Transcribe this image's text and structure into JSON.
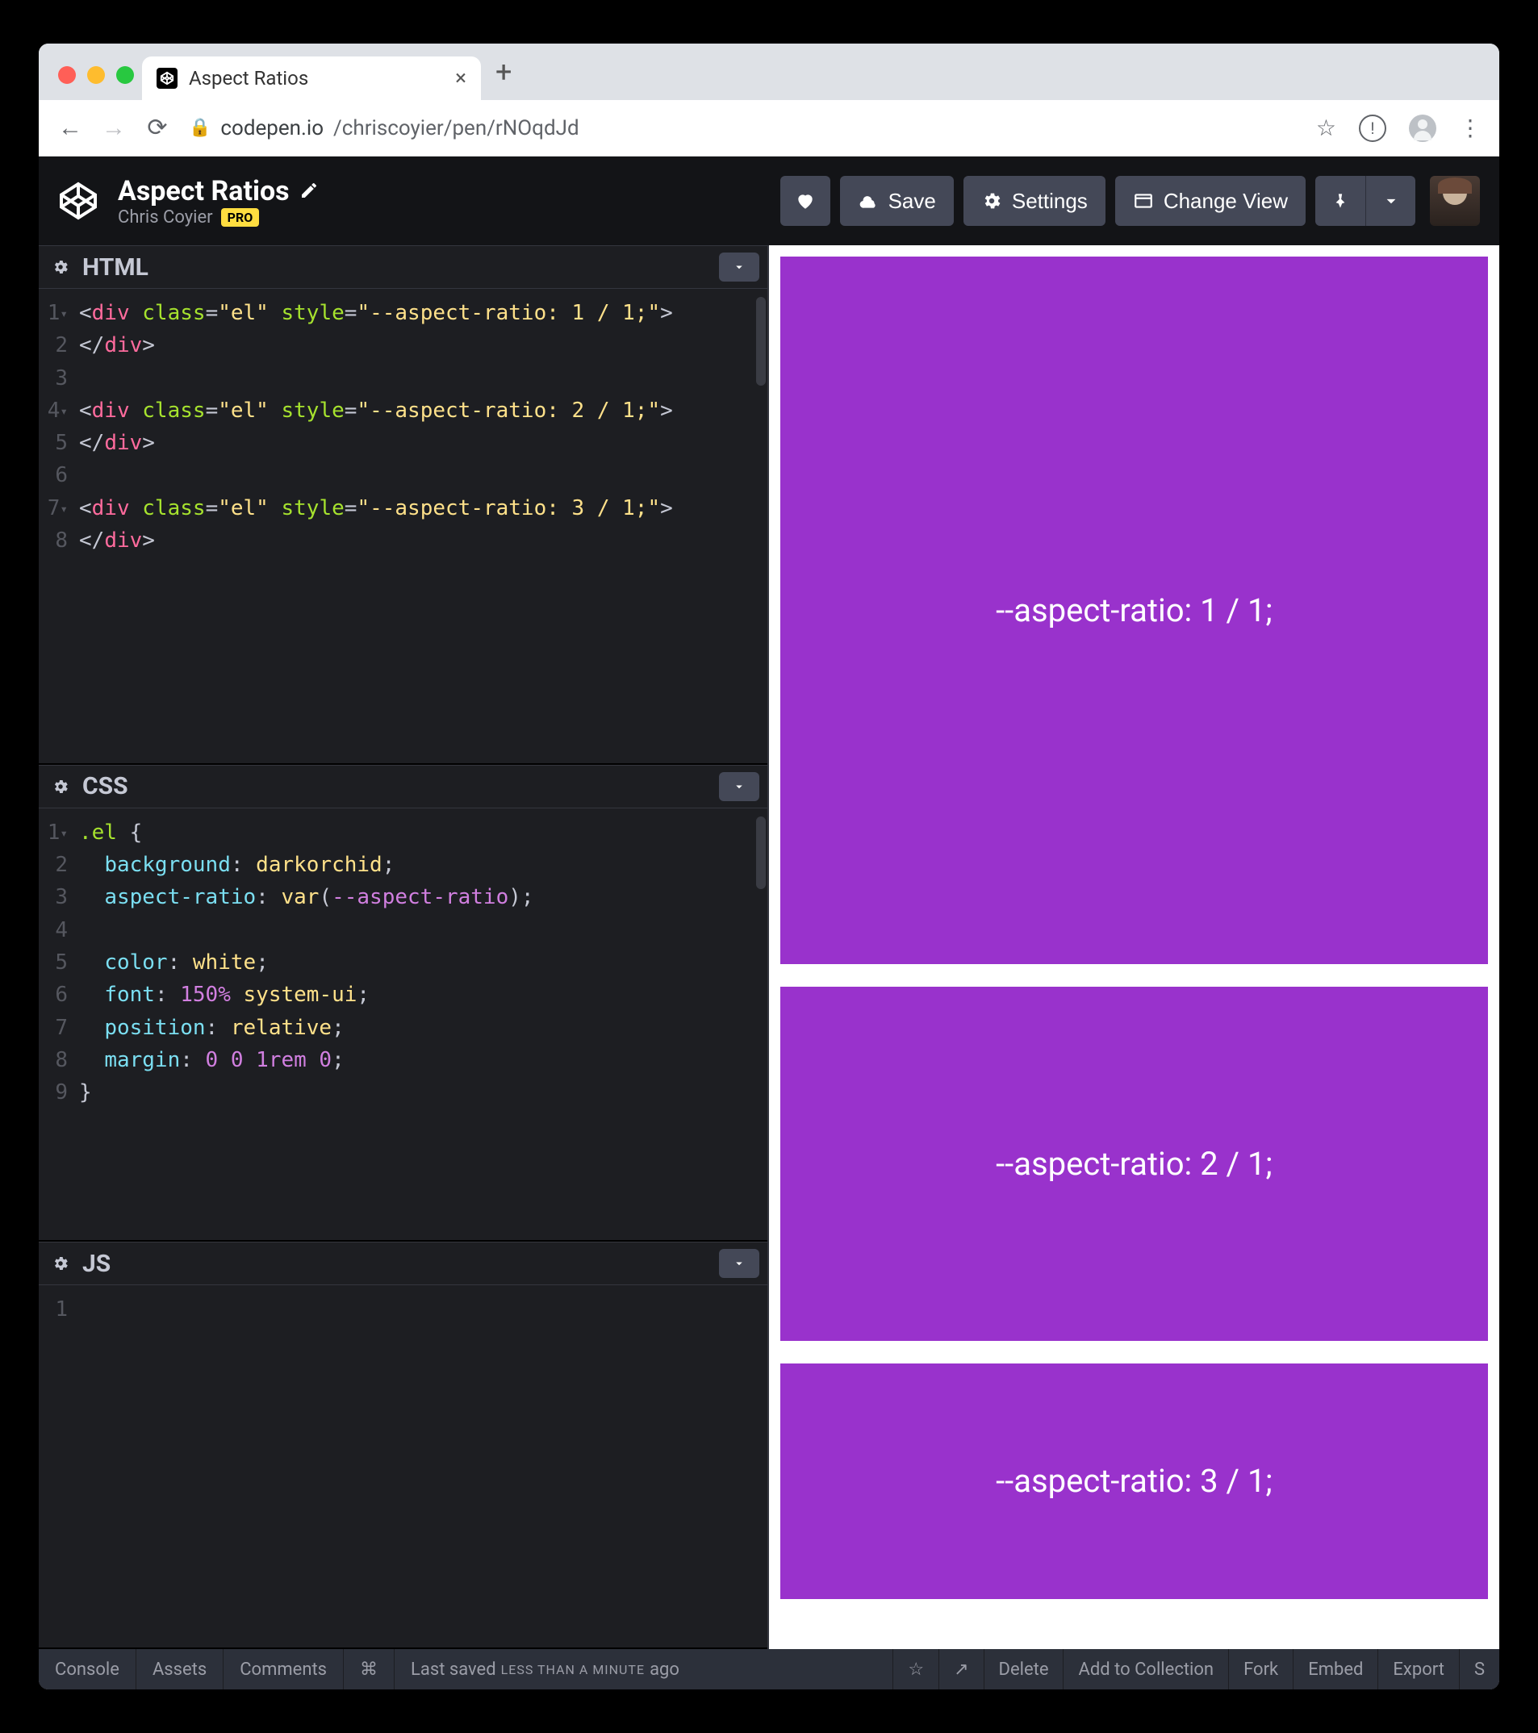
{
  "browser": {
    "tab_title": "Aspect Ratios",
    "url_host": "codepen.io",
    "url_path": "/chriscoyier/pen/rNOqdJd"
  },
  "header": {
    "pen_title": "Aspect Ratios",
    "author": "Chris Coyier",
    "pro_label": "PRO",
    "save_label": "Save",
    "settings_label": "Settings",
    "change_view_label": "Change View"
  },
  "panels": {
    "html": {
      "title": "HTML"
    },
    "css": {
      "title": "CSS"
    },
    "js": {
      "title": "JS"
    }
  },
  "code": {
    "html_lines": [
      "1",
      "2",
      "3",
      "4",
      "5",
      "6",
      "7",
      "8"
    ],
    "html": "<div class=\"el\" style=\"--aspect-ratio: 1 / 1;\">\n</div>\n\n<div class=\"el\" style=\"--aspect-ratio: 2 / 1;\">\n</div>\n\n<div class=\"el\" style=\"--aspect-ratio: 3 / 1;\">\n</div>",
    "css_lines": [
      "1",
      "2",
      "3",
      "4",
      "5",
      "6",
      "7",
      "8",
      "9"
    ],
    "css": ".el {\n  background: darkorchid;\n  aspect-ratio: var(--aspect-ratio);\n\n  color: white;\n  font: 150% system-ui;\n  position: relative;\n  margin: 0 0 1rem 0;\n}",
    "js_lines": [
      "1"
    ],
    "js": ""
  },
  "preview": {
    "box1": "--aspect-ratio: 1 / 1;",
    "box2": "--aspect-ratio: 2 / 1;",
    "box3": "--aspect-ratio: 3 / 1;"
  },
  "footer": {
    "console": "Console",
    "assets": "Assets",
    "comments": "Comments",
    "shortcuts": "⌘",
    "saved_prefix": "Last saved",
    "saved_rel": "LESS THAN A MINUTE",
    "saved_suffix": "ago",
    "delete": "Delete",
    "add": "Add to Collection",
    "fork": "Fork",
    "embed": "Embed",
    "export": "Export",
    "share": "S"
  }
}
